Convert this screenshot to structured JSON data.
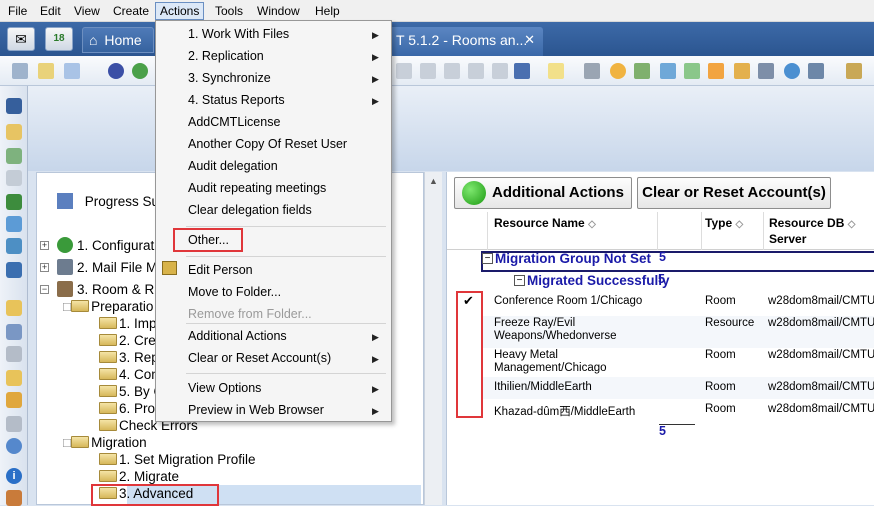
{
  "menubar": {
    "items": [
      "File",
      "Edit",
      "View",
      "Create",
      "Actions",
      "Tools",
      "Window",
      "Help"
    ]
  },
  "tabs": {
    "home_label": "Home",
    "calendar_badge": "18",
    "doc_tab_label": "T 5.1.2 - Rooms an...",
    "close_glyph": "✕"
  },
  "actions_menu": {
    "items": [
      {
        "label": "1. Work With Files",
        "submenu": true
      },
      {
        "label": "2. Replication",
        "submenu": true
      },
      {
        "label": "3. Synchronize",
        "submenu": true
      },
      {
        "label": "4. Status Reports",
        "submenu": true
      },
      {
        "label": "AddCMTLicense"
      },
      {
        "label": "Another Copy Of Reset User"
      },
      {
        "label": "Audit delegation"
      },
      {
        "label": "Audit repeating meetings"
      },
      {
        "label": "Clear delegation fields"
      },
      {
        "label": "Other..."
      },
      {
        "label": "Edit Person"
      },
      {
        "label": "Move to Folder..."
      },
      {
        "label": "Remove from Folder..."
      },
      {
        "label": "Additional Actions",
        "submenu": true
      },
      {
        "label": "Clear or Reset Account(s)",
        "submenu": true
      },
      {
        "label": "View Options",
        "submenu": true
      },
      {
        "label": "Preview in Web Browser",
        "submenu": true
      }
    ]
  },
  "tree": {
    "progress": "Progress Su",
    "nodes": [
      "1. Configurat",
      "2. Mail File M",
      "3. Room & R",
      "Preparatio",
      "1. Imp",
      "2. Cre",
      "3. Rep",
      "4. Con",
      "5. By C",
      "6. Pro",
      "Check Errors",
      "Migration",
      "1. Set Migration Profile",
      "2. Migrate",
      "3. Advanced"
    ]
  },
  "right": {
    "additional_actions": "Additional Actions",
    "clear_reset": "Clear or Reset Account(s)",
    "columns": {
      "resource_name": "Resource Name",
      "type": "Type",
      "resource_db": "Resource DB",
      "server": "Server"
    },
    "group_label": "Migration Group Not Set",
    "group_count": "5",
    "subgroup_label": "Migrated Successfully",
    "subgroup_count": "5",
    "total_count": "5",
    "checkmark": "✔",
    "rows": [
      {
        "name1": "Conference Room 1/Chicago",
        "name2": "",
        "type": "Room",
        "server": "w28dom8mail/CMTU"
      },
      {
        "name1": "Freeze Ray/Evil",
        "name2": "Weapons/Whedonverse",
        "type": "Resource",
        "server": "w28dom8mail/CMTU"
      },
      {
        "name1": "Heavy Metal",
        "name2": "Management/Chicago",
        "type": "Room",
        "server": "w28dom8mail/CMTU"
      },
      {
        "name1": "Ithilien/MiddleEarth",
        "name2": "",
        "type": "Room",
        "server": "w28dom8mail/CMTU"
      },
      {
        "name1": "Khazad-dûm西/MiddleEarth",
        "name2": "",
        "type": "Room",
        "server": "w28dom8mail/CMTU"
      }
    ]
  },
  "colors": {
    "accent": "#2b5590",
    "highlight": "#e0363a",
    "link_blue": "#1a1aa8"
  }
}
